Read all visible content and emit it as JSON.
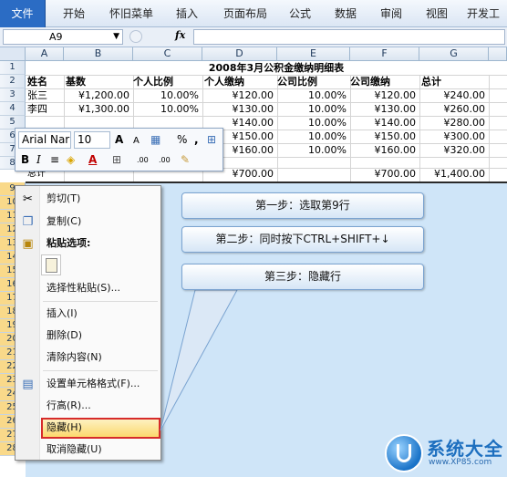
{
  "ribbon": {
    "tabs": [
      "文件",
      "开始",
      "怀旧菜单",
      "插入",
      "页面布局",
      "公式",
      "数据",
      "审阅",
      "视图",
      "开发工具"
    ]
  },
  "formula_bar": {
    "name_box": "A9",
    "fx_label": "fx",
    "formula": ""
  },
  "columns": [
    "A",
    "B",
    "C",
    "D",
    "E",
    "F",
    "G"
  ],
  "rows": [
    "1",
    "2",
    "3",
    "4",
    "5",
    "6",
    "7",
    "8",
    "9",
    "10",
    "11",
    "12",
    "13",
    "14",
    "15",
    "16",
    "17",
    "18",
    "19",
    "20",
    "21",
    "22",
    "23",
    "24",
    "25",
    "26",
    "27",
    "28"
  ],
  "sheet": {
    "title": "2008年3月公积金缴纳明细表",
    "headers": [
      "姓名",
      "基数",
      "个人比例",
      "个人缴纳",
      "公司比例",
      "公司缴纳",
      "总计"
    ],
    "data_rows": [
      [
        "张三",
        "¥1,200.00",
        "10.00%",
        "¥120.00",
        "10.00%",
        "¥120.00",
        "¥240.00"
      ],
      [
        "李四",
        "¥1,300.00",
        "10.00%",
        "¥130.00",
        "10.00%",
        "¥130.00",
        "¥260.00"
      ],
      [
        "",
        "",
        "",
        "¥140.00",
        "10.00%",
        "¥140.00",
        "¥280.00"
      ],
      [
        "",
        "",
        "",
        "¥150.00",
        "10.00%",
        "¥150.00",
        "¥300.00"
      ],
      [
        "",
        "",
        "",
        "¥160.00",
        "10.00%",
        "¥160.00",
        "¥320.00"
      ]
    ],
    "total_row": [
      "总计",
      "",
      "",
      "¥700.00",
      "",
      "¥700.00",
      "¥1,400.00"
    ]
  },
  "mini_toolbar": {
    "font_name": "Arial Nar",
    "font_size": "10",
    "grow_font": "A",
    "shrink_font": "A",
    "percent": "%",
    "comma": ",",
    "bold": "B",
    "italic": "I",
    "font_color": "A",
    "inc_decimal": ".00",
    "dec_decimal": ".00"
  },
  "context_menu": {
    "cut": "剪切(T)",
    "copy": "复制(C)",
    "paste_options": "粘贴选项:",
    "paste_special": "选择性粘贴(S)...",
    "insert": "插入(I)",
    "delete": "删除(D)",
    "clear": "清除内容(N)",
    "format_cells": "设置单元格格式(F)...",
    "row_height": "行高(R)...",
    "hide": "隐藏(H)",
    "unhide": "取消隐藏(U)"
  },
  "steps": {
    "step1": "第一步：选取第9行",
    "step2": "第二步：同时按下CTRL+SHIFT+↓",
    "step3": "第三步：隐藏行"
  },
  "watermark": {
    "name": "系统大全",
    "url": "www.XP85.com"
  },
  "colors": {
    "selection": "#cfe5f8",
    "file_tab": "#2b6cc4",
    "highlight_border": "#d62b2b"
  }
}
